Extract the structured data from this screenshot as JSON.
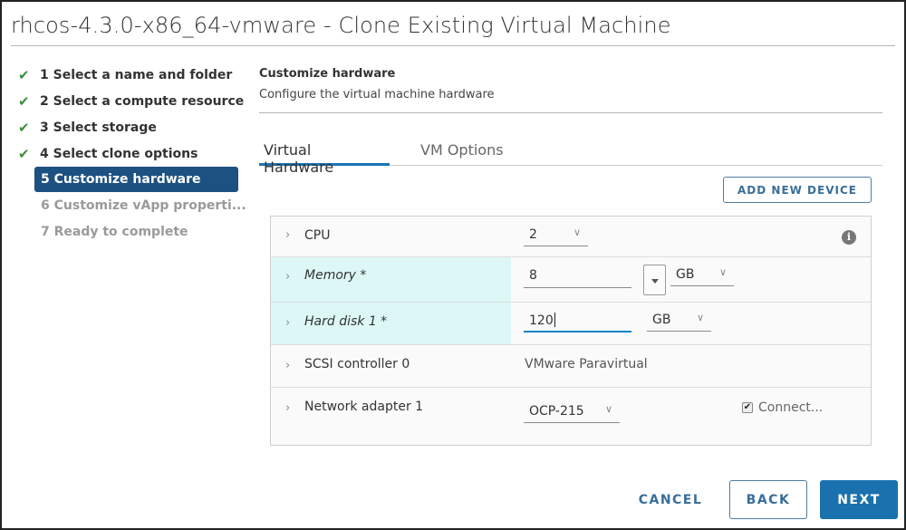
{
  "window": {
    "title": "rhcos-4.3.0-x86_64-vmware - Clone Existing Virtual Machine"
  },
  "steps": [
    {
      "number": "1",
      "label": "1 Select a name and folder",
      "state": "completed",
      "icon": "check-icon"
    },
    {
      "number": "2",
      "label": "2 Select a compute resource",
      "state": "completed",
      "icon": "check-icon"
    },
    {
      "number": "3",
      "label": "3 Select storage",
      "state": "completed",
      "icon": "check-icon"
    },
    {
      "number": "4",
      "label": "4 Select clone options",
      "state": "completed",
      "icon": "check-icon"
    },
    {
      "number": "5",
      "label": "5 Customize hardware",
      "state": "active"
    },
    {
      "number": "6",
      "label": "6 Customize vApp properti...",
      "state": "disabled"
    },
    {
      "number": "7",
      "label": "7 Ready to complete",
      "state": "disabled"
    }
  ],
  "section": {
    "title": "Customize hardware",
    "subtitle": "Configure the virtual machine hardware"
  },
  "tabs": [
    {
      "label": "Virtual Hardware",
      "active": true
    },
    {
      "label": "VM Options",
      "active": false
    }
  ],
  "toolbar": {
    "add_device_label": "ADD NEW DEVICE"
  },
  "hardware": {
    "cpu": {
      "label": "CPU",
      "value": "2",
      "icon": "info-icon"
    },
    "memory": {
      "label": "Memory *",
      "value": "8",
      "unit": "GB"
    },
    "hard_disk": {
      "label": "Hard disk 1 *",
      "value": "120",
      "unit": "GB"
    },
    "scsi": {
      "label": "SCSI controller 0",
      "value": "VMware Paravirtual"
    },
    "network": {
      "label": "Network adapter 1",
      "value": "OCP-215",
      "connect_label": "Connect...",
      "connect_checked": true
    }
  },
  "footer": {
    "cancel_label": "CANCEL",
    "back_label": "BACK",
    "next_label": "NEXT"
  },
  "colors": {
    "accent": "#1a71ad",
    "active_step": "#1d5181",
    "check": "#3c8f3c",
    "row_highlight": "#ddf7f7"
  }
}
